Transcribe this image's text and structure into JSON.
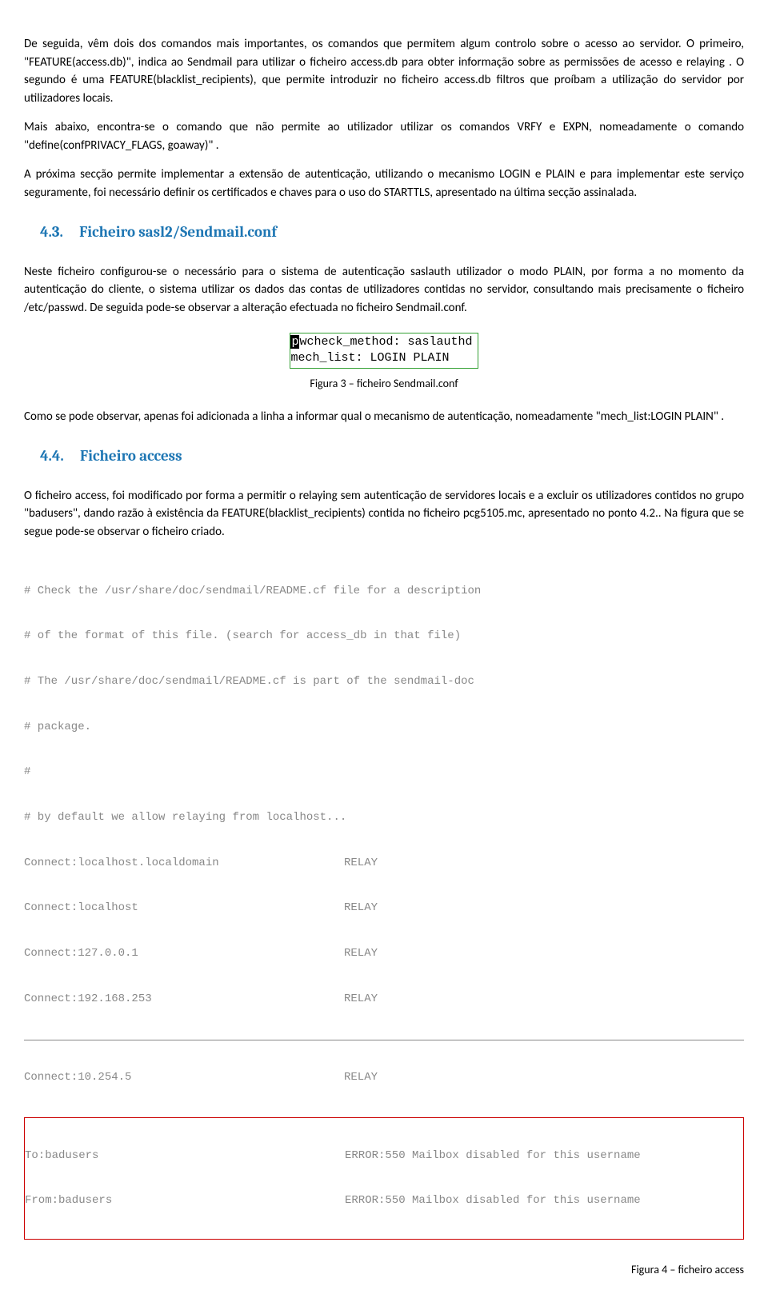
{
  "paragraphs": {
    "p1": "De seguida, vêm dois dos comandos mais importantes, os comandos que permitem algum controlo sobre o acesso ao servidor. O primeiro, \"FEATURE(access.db)\", indica ao Sendmail para utilizar o ficheiro access.db para obter informação sobre as permissões de acesso e relaying . O segundo é uma FEATURE(blacklist_recipients), que permite introduzir no ficheiro access.db filtros que proíbam a utilização do servidor por utilizadores locais.",
    "p2": "Mais abaixo, encontra-se o comando que não permite ao utilizador utilizar os comandos VRFY e EXPN, nomeadamente o comando \"define(confPRIVACY_FLAGS, goaway)\" .",
    "p3": "A próxima secção permite implementar a extensão de autenticação, utilizando o mecanismo LOGIN e PLAIN e para implementar este serviço seguramente, foi necessário definir os certificados e chaves para o uso do STARTTLS, apresentado na última secção assinalada.",
    "p4": "Neste ficheiro configurou-se o necessário para o sistema de autenticação saslauth utilizador o modo PLAIN, por forma a no momento da autenticação do cliente, o sistema utilizar os dados das contas de utilizadores contidas no servidor, consultando mais precisamente o ficheiro /etc/passwd. De seguida pode-se observar a alteração efectuada no ficheiro Sendmail.conf.",
    "p5": "Como se pode observar, apenas foi adicionada a linha a informar qual o mecanismo de autenticação, nomeadamente \"mech_list:LOGIN PLAIN\" .",
    "p6": "O ficheiro access, foi modificado por forma a permitir o relaying sem autenticação de servidores locais e a excluir os utilizadores contidos no grupo \"badusers\", dando razão à existência da FEATURE(blacklist_recipients) contida no ficheiro pcg5105.mc, apresentado no ponto 4.2.. Na figura que se segue pode-se observar o ficheiro criado."
  },
  "headings": {
    "h43_num": "4.3.",
    "h43_title": "Ficheiro sasl2/Sendmail.conf",
    "h44_num": "4.4.",
    "h44_title": "Ficheiro access"
  },
  "figure3": {
    "line1_first": "p",
    "line1_rest": "wcheck_method: saslauthd",
    "line2": "mech_list: LOGIN PLAIN",
    "caption": "Figura 3 – ficheiro Sendmail.conf"
  },
  "figure4": {
    "comments": [
      "# Check the /usr/share/doc/sendmail/README.cf file for a description",
      "# of the format of this file. (search for access_db in that file)",
      "# The /usr/share/doc/sendmail/README.cf is part of the sendmail-doc",
      "# package.",
      "#",
      "# by default we allow relaying from localhost..."
    ],
    "relay_rows": [
      {
        "c1": "Connect:localhost.localdomain",
        "c2": "RELAY"
      },
      {
        "c1": "Connect:localhost",
        "c2": "RELAY"
      },
      {
        "c1": "Connect:127.0.0.1",
        "c2": "RELAY"
      },
      {
        "c1": "Connect:192.168.253",
        "c2": "RELAY"
      },
      {
        "c1": "Connect:10.254.5",
        "c2": "RELAY"
      }
    ],
    "error_rows": [
      {
        "c1": "To:badusers",
        "c2": "ERROR:550 Mailbox disabled for this username"
      },
      {
        "c1": "From:badusers",
        "c2": "ERROR:550 Mailbox disabled for this username"
      }
    ],
    "caption": "Figura 4 – ficheiro access"
  }
}
